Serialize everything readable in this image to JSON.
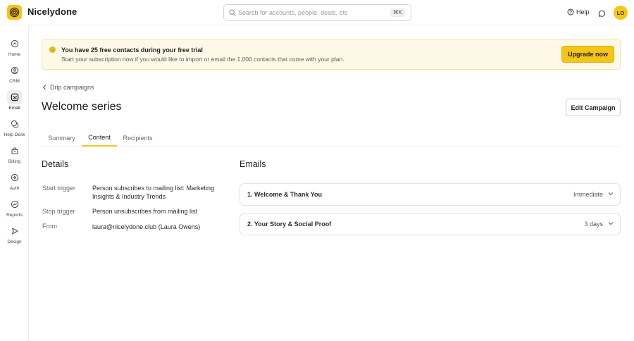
{
  "app": {
    "name": "Nicelydone"
  },
  "search": {
    "placeholder": "Search for accounts, people, deals, etc",
    "shortcut": "⌘K"
  },
  "header": {
    "help_label": "Help",
    "avatar_initials": "LO"
  },
  "sidebar": {
    "items": [
      {
        "label": "Home",
        "icon": "home-icon"
      },
      {
        "label": "CRM",
        "icon": "crm-icon"
      },
      {
        "label": "Email",
        "icon": "email-icon",
        "active": true
      },
      {
        "label": "Help Desk",
        "icon": "help-desk-icon"
      },
      {
        "label": "Billing",
        "icon": "billing-icon"
      },
      {
        "label": "Auth",
        "icon": "auth-icon"
      },
      {
        "label": "Reports",
        "icon": "reports-icon"
      },
      {
        "label": "Design",
        "icon": "design-icon"
      }
    ]
  },
  "banner": {
    "title": "You have 25 free contacts during your free trial",
    "subtitle": "Start your subscription now if you would like to import or email the 1,000 contacts that come with your plan.",
    "button_label": "Upgrade now"
  },
  "breadcrumb": {
    "label": "Drip campaigns"
  },
  "page": {
    "title": "Welcome series",
    "edit_button_label": "Edit Campaign"
  },
  "tabs": [
    {
      "label": "Summary",
      "active": false
    },
    {
      "label": "Content",
      "active": true
    },
    {
      "label": "Recipients",
      "active": false
    }
  ],
  "details": {
    "title": "Details",
    "rows": [
      {
        "label": "Start trigger",
        "value": "Person subscribes to mailing list: Marketing Insights & Industry Trends"
      },
      {
        "label": "Stop trigger",
        "value": "Person unsubscribes from mailing list"
      },
      {
        "label": "From",
        "value": "laura@nicelydone.club (Laura Owens)"
      }
    ]
  },
  "emails": {
    "title": "Emails",
    "items": [
      {
        "title": "1. Welcome & Thank You",
        "delay": "Immediate"
      },
      {
        "title": "2. Your Story & Social Proof",
        "delay": "3 days"
      }
    ]
  },
  "colors": {
    "accent": "#f5c518",
    "banner_bg": "#fef9e7"
  }
}
